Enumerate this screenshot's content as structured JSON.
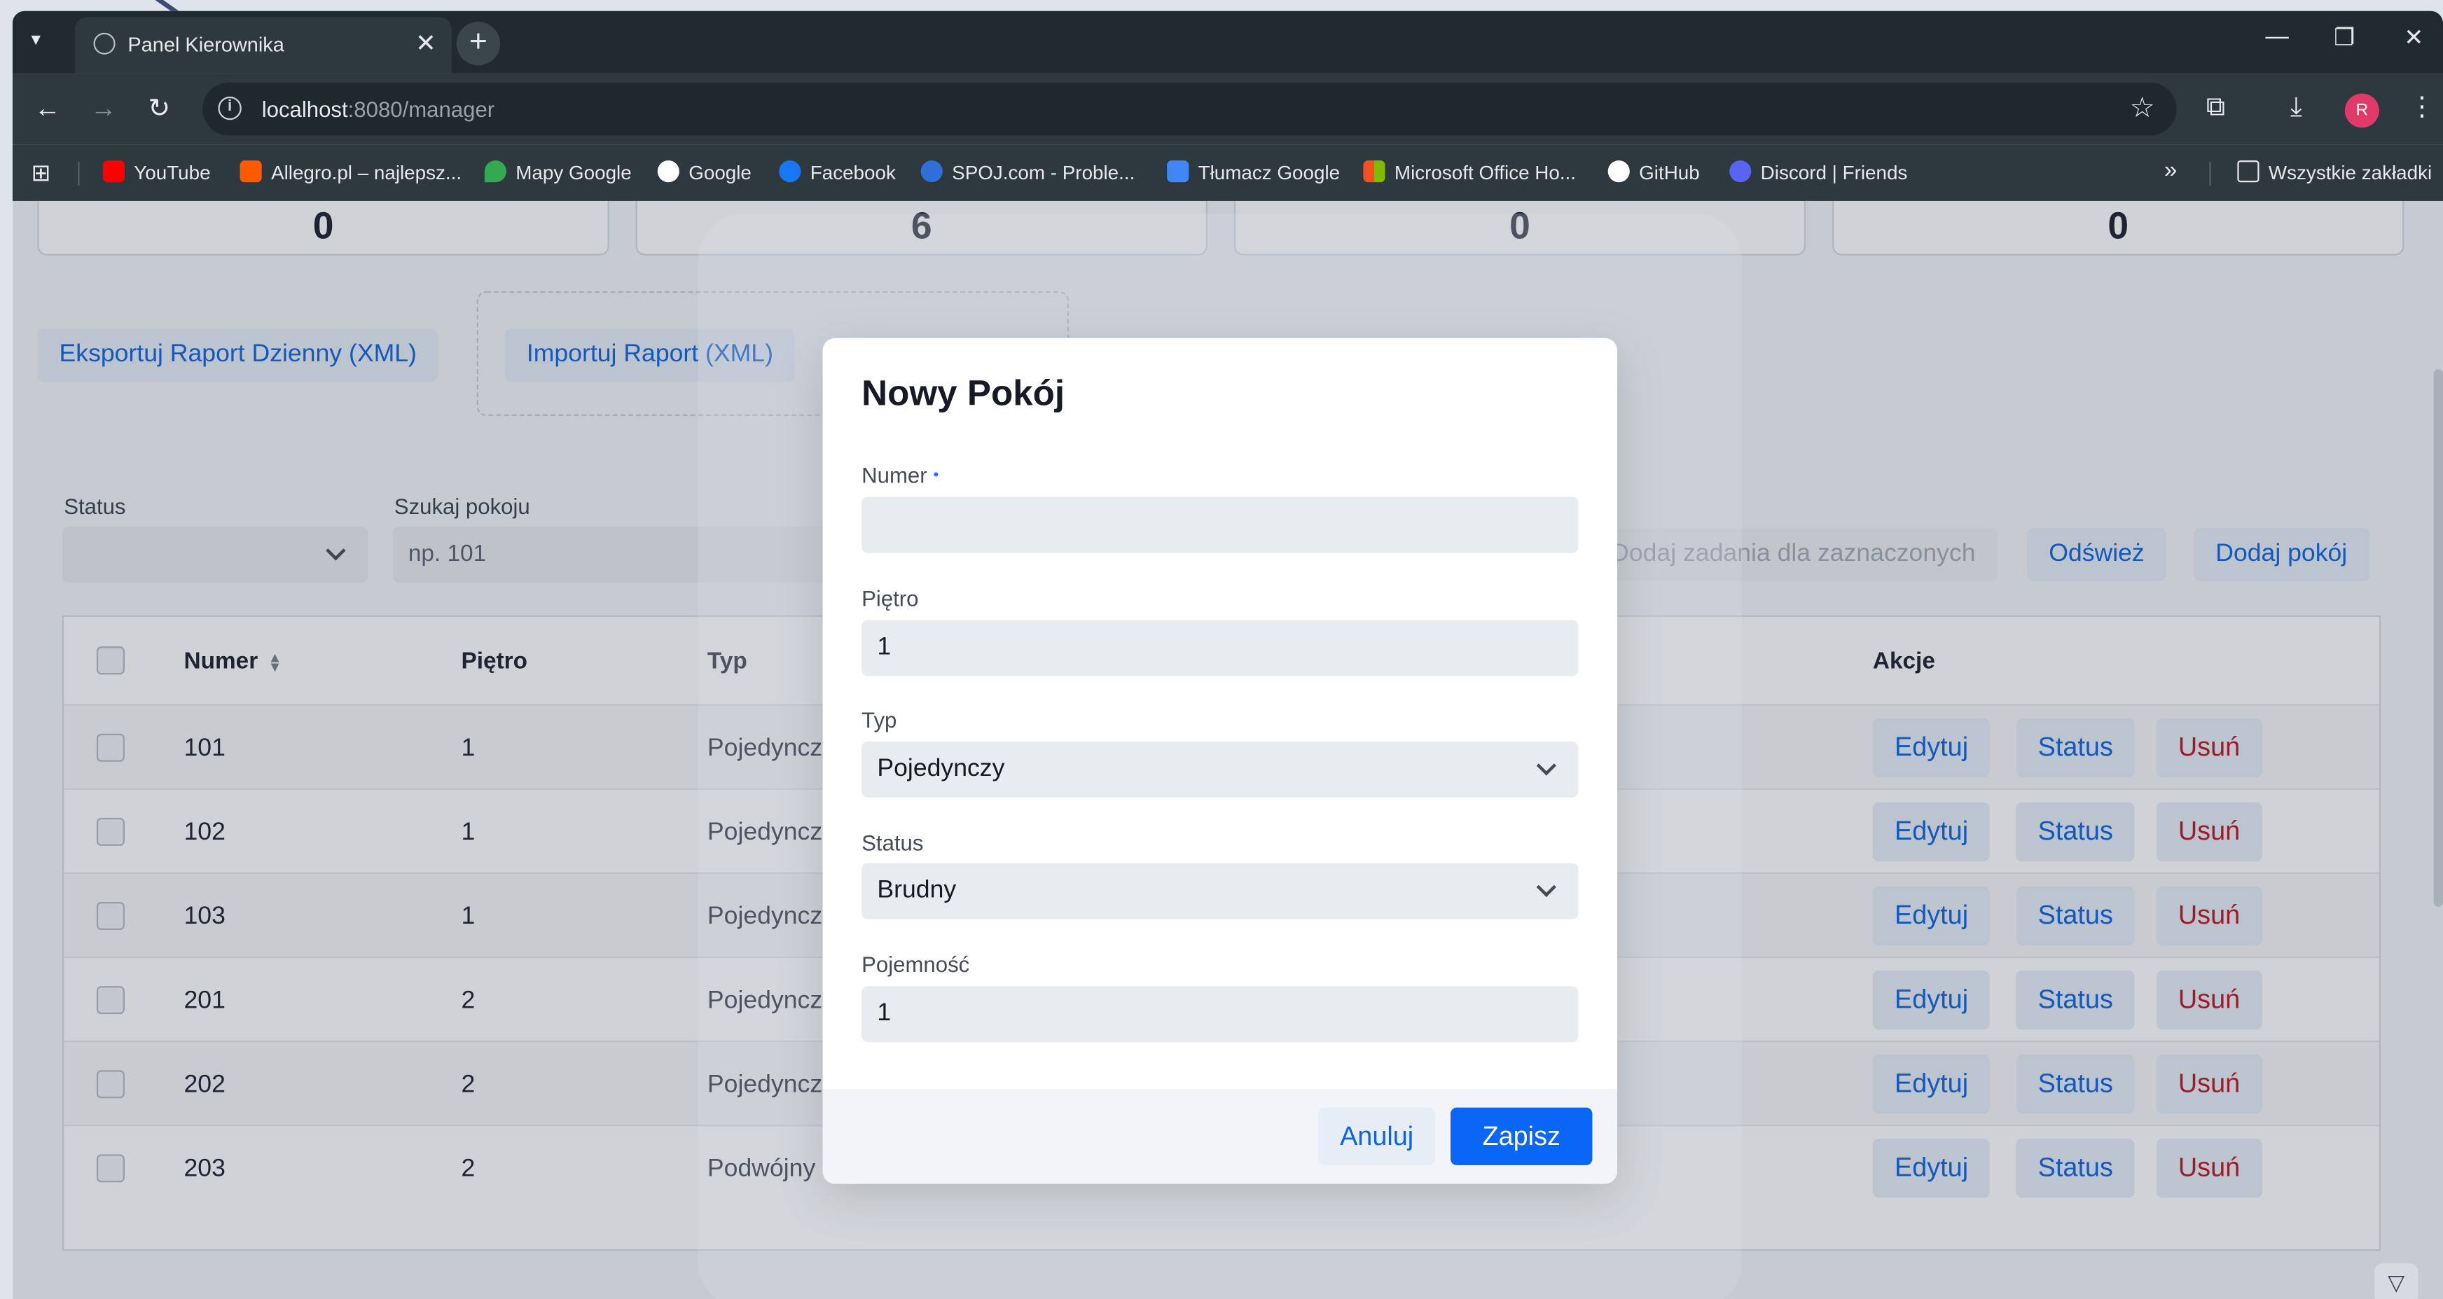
{
  "browser": {
    "tab_title": "Panel Kierownika",
    "tab_close": "✕",
    "new_tab": "+",
    "url_host": "localhost",
    "url_rest": ":8080/manager",
    "bookmarks": [
      {
        "label": "YouTube",
        "color": "#ff0000"
      },
      {
        "label": "Allegro.pl – najlepsz...",
        "color": "#ff5a00"
      },
      {
        "label": "Mapy Google",
        "color": "#34a853"
      },
      {
        "label": "Google",
        "color": "#ffffff"
      },
      {
        "label": "Facebook",
        "color": "#1877f2"
      },
      {
        "label": "SPOJ.com - Proble...",
        "color": "#2f6fd8"
      },
      {
        "label": "Tłumacz Google",
        "color": "#4285f4"
      },
      {
        "label": "Microsoft Office Ho...",
        "color": "#f25022"
      },
      {
        "label": "GitHub",
        "color": "#ffffff"
      },
      {
        "label": "Discord | Friends",
        "color": "#5865f2"
      }
    ],
    "bookmarks_more": "»",
    "all_bookmarks": "Wszystkie zakładki",
    "avatar_letter": "R"
  },
  "stats": [
    "0",
    "6",
    "0",
    "0"
  ],
  "actions": {
    "export_label": "Eksportuj Raport Dzienny (XML)",
    "import_label": "Importuj Raport (XML)",
    "bulk_tasks_label": "Dodaj zadania dla zaznaczonych",
    "refresh_label": "Odśwież",
    "add_room_label": "Dodaj pokój"
  },
  "filters": {
    "status_label": "Status",
    "search_label": "Szukaj pokoju",
    "search_placeholder": "np. 101"
  },
  "table": {
    "headers": {
      "number": "Numer",
      "floor": "Piętro",
      "type": "Typ",
      "actions": "Akcje"
    },
    "rows": [
      {
        "number": "101",
        "floor": "1",
        "type": "Pojedynczy"
      },
      {
        "number": "102",
        "floor": "1",
        "type": "Pojedynczy"
      },
      {
        "number": "103",
        "floor": "1",
        "type": "Pojedynczy"
      },
      {
        "number": "201",
        "floor": "2",
        "type": "Pojedynczy"
      },
      {
        "number": "202",
        "floor": "2",
        "type": "Pojedynczy"
      },
      {
        "number": "203",
        "floor": "2",
        "type": "Podwójny"
      }
    ],
    "edit_label": "Edytuj",
    "status_label": "Status",
    "delete_label": "Usuń"
  },
  "modal": {
    "title": "Nowy Pokój",
    "number_label": "Numer",
    "number_required": "•",
    "number_value": "",
    "floor_label": "Piętro",
    "floor_value": "1",
    "type_label": "Typ",
    "type_value": "Pojedynczy",
    "status_label": "Status",
    "status_value": "Brudny",
    "capacity_label": "Pojemność",
    "capacity_value": "1",
    "cancel_label": "Anuluj",
    "save_label": "Zapisz"
  }
}
